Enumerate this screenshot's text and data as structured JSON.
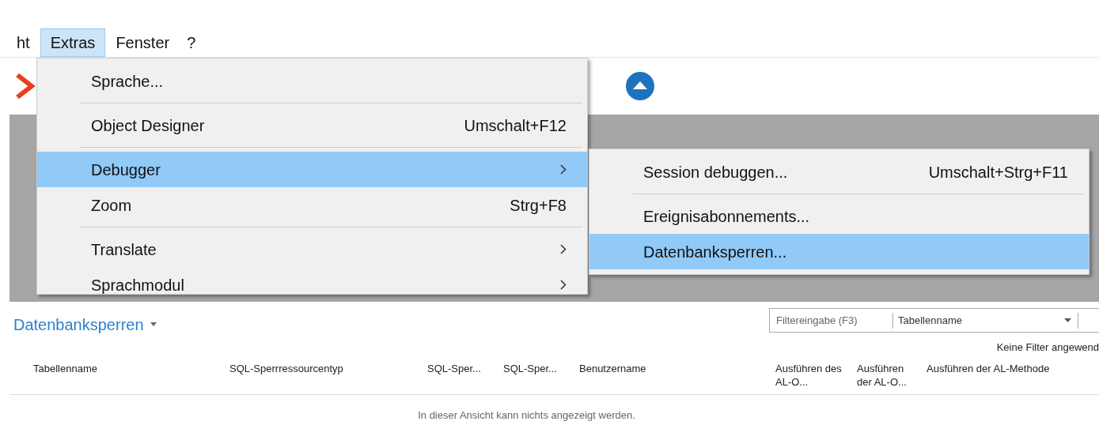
{
  "menu_bar": [
    {
      "label": "ht",
      "selected": false
    },
    {
      "label": "Extras",
      "selected": true
    },
    {
      "label": "Fenster",
      "selected": false
    },
    {
      "label": "?",
      "selected": false
    }
  ],
  "menu": [
    {
      "label": "Sprache...",
      "submenu": false,
      "selected": false,
      "separator_after": true
    },
    {
      "label": "Object Designer",
      "shortcut": "Umschalt+F12",
      "submenu": false,
      "selected": false,
      "separator_after": true
    },
    {
      "label": "Debugger",
      "submenu": true,
      "selected": true,
      "separator_after": false
    },
    {
      "label": "Zoom",
      "shortcut": "Strg+F8",
      "submenu": false,
      "selected": false,
      "separator_after": true
    },
    {
      "label": "Translate",
      "submenu": true,
      "selected": false,
      "separator_after": false
    },
    {
      "label": "Sprachmodul",
      "submenu": true,
      "selected": false,
      "separator_after": false
    }
  ],
  "submenu": [
    {
      "label": "Session debuggen...",
      "shortcut": "Umschalt+Strg+F11",
      "selected": false,
      "separator_after": true
    },
    {
      "label": "Ereignisabonnements...",
      "selected": false,
      "separator_after": false
    },
    {
      "label": "Datenbanksperren...",
      "selected": true,
      "separator_after": false
    }
  ],
  "page": {
    "title": "Datenbanksperren",
    "filter": {
      "placeholder": "Filtereingabe (F3)",
      "field": "Tabellenname"
    },
    "filter_status": "Keine Filter angewend",
    "columns": [
      "Tabellenname",
      "SQL-Sperrressourcentyp",
      "SQL-Sper...",
      "SQL-Sper...",
      "Benutzername",
      "Ausführen des AL-O...",
      "Ausführen der AL-O...",
      "Ausführen der AL-Methode"
    ],
    "empty_message": "In dieser Ansicht kann nichts angezeigt werden."
  }
}
